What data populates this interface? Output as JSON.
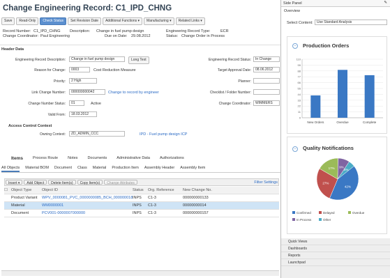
{
  "title": "Change Engineering Record: C1_IPD_CHNG",
  "toolbar": {
    "buttons": [
      "Save",
      "Read-Only",
      "Check Status",
      "Set Revision Date",
      "Additional Functions ▾",
      "Manufacturing ▾",
      "Related Links ▾"
    ]
  },
  "summary": {
    "rec_number_label": "Record Number:",
    "rec_number_value": "C1_IPD_CHNG",
    "description_label": "Description:",
    "description_value": "Change in fuel pump design",
    "ecr_type_label": "Engineering Record Type:",
    "ecr_type_value": "ECR",
    "coordinator_label": "Change Coordinator:",
    "coordinator_value": "Paul Engineering",
    "due_date_label": "Due on Date:",
    "due_date_value": "29.08.2012",
    "status_label": "Status:",
    "status_value": "Change Order in Process"
  },
  "header_data": {
    "section_title": "Header Data",
    "fields": [
      {
        "label": "Engineering Record Description:",
        "value": "Change in fuel pump design",
        "extra": "Long Text"
      },
      {
        "label": "Reason for Change:",
        "value": "0003",
        "extra": "Cost Reduction Measure"
      },
      {
        "label": "Priority:",
        "value": "2 High"
      },
      {
        "label": "Link Change Number:",
        "value": "000000000042",
        "extra": "Change to record by engineer"
      },
      {
        "label": "Change Number Status:",
        "value": "01",
        "extra": "Active"
      },
      {
        "label": "Valid From:",
        "value": "18.03.2012"
      }
    ],
    "right_fields": [
      {
        "label": "Engineering Record Status:",
        "value": "In Change"
      },
      {
        "label": "Target Approval Date:",
        "value": "08.06.2012"
      },
      {
        "label": "Planner:",
        "value": ""
      },
      {
        "label": "Checklist / Folder Number:",
        "value": ""
      },
      {
        "label": "Change Coordinator:",
        "value": "WIMMERS"
      }
    ]
  },
  "access_control": {
    "section_title": "Access Control Context",
    "label": "Owning Context:",
    "value": "ZD_ADMIN_CCC",
    "link": "IPD - Fuel pump design ICP"
  },
  "tabs1": [
    "Items",
    "Process Route",
    "Notes",
    "Documents",
    "Administrative Data",
    "Authorizations"
  ],
  "tabs2": [
    "All Objects",
    "Material BOM",
    "Document",
    "Class",
    "Material",
    "Production Item",
    "Assembly Header",
    "Assembly Item"
  ],
  "grid_toolbar": [
    "Insert ▾",
    "Add Object",
    "Delete Item(s)",
    "Copy Item(s)",
    "Change Attributes"
  ],
  "grid_settings": "Filter  Settings",
  "grid": {
    "columns": [
      "",
      "Object Type",
      "Object ID",
      "Status",
      "Org. Reference",
      "New Change No."
    ],
    "rows": [
      [
        "",
        "Product Variant",
        "WPV_0000081_PVC_0000000085_BCH_0000000188",
        "INPS",
        "C1-3",
        "000000000133"
      ],
      [
        "",
        "Material",
        "WM0000001",
        "INPS",
        "C1-3",
        "00000000014"
      ],
      [
        "",
        "Document",
        "PCV001-0000007000000",
        "INPS",
        "C1-3",
        "000000000157"
      ]
    ]
  },
  "side": {
    "title": "Side Panel",
    "overview": "Overview",
    "select_label": "Select Content:",
    "select_value": "Use Standard Analysis",
    "prod_title": "Production Orders",
    "qual_title": "Quality Notifications",
    "bottom_items": [
      "Quick Views",
      "Dashboards",
      "Reports",
      "Launchpad"
    ]
  },
  "chart_data": [
    {
      "type": "bar",
      "title": "Production Orders",
      "categories": [
        "New Orders",
        "Overdue",
        "Complete"
      ],
      "values": [
        42,
        90,
        80
      ],
      "ylim": [
        0,
        110
      ],
      "color": "#3a78c4"
    },
    {
      "type": "pie",
      "title": "Quality Notifications",
      "labels": [
        "Confirmed",
        "Delayed",
        "Overdue",
        "In Process",
        "Other"
      ],
      "values": [
        42,
        27,
        17,
        9,
        5
      ],
      "colors": [
        "#3a78c4",
        "#c0504d",
        "#9bbb59",
        "#8064a2",
        "#4bacc6"
      ],
      "slice_labels": [
        "42%",
        "27%",
        "17%",
        "9%",
        "5%"
      ]
    }
  ]
}
